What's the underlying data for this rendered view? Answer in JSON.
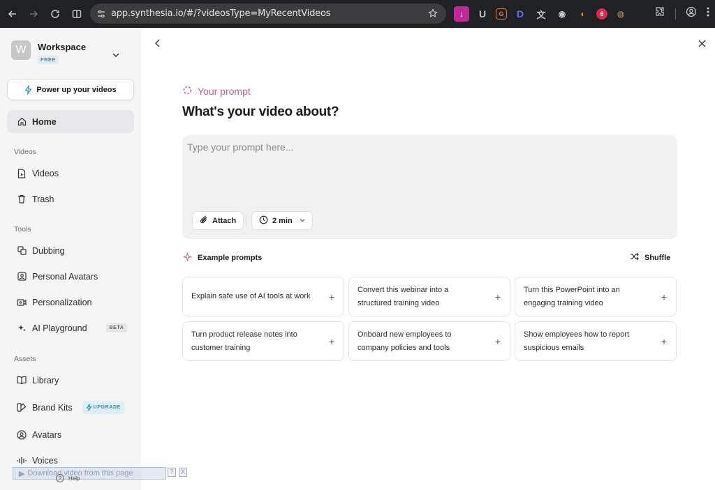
{
  "browser": {
    "url": "app.synthesia.io/#/?videosType=MyRecentVideos",
    "extensions": [
      {
        "name": "downloader-extension",
        "glyph": "↓",
        "bg": "#c0289a"
      },
      {
        "name": "u-extension",
        "glyph": "U",
        "bg": "transparent"
      },
      {
        "name": "grammar-extension",
        "glyph": "G",
        "bg": "transparent"
      },
      {
        "name": "d-extension",
        "glyph": "D",
        "bg": "transparent"
      },
      {
        "name": "translate-extension",
        "glyph": "文",
        "bg": "transparent"
      },
      {
        "name": "camera-extension",
        "glyph": "◉",
        "bg": "transparent"
      },
      {
        "name": "flame-extension",
        "glyph": "◐",
        "bg": "transparent"
      },
      {
        "name": "red-extension",
        "glyph": "6",
        "bg": "transparent"
      },
      {
        "name": "cookie-extension",
        "glyph": "◍",
        "bg": "transparent"
      }
    ]
  },
  "sidebar": {
    "workspace": {
      "initial": "W",
      "name": "Workspace",
      "plan": "FREE"
    },
    "powerup_label": "Power up your videos",
    "home_label": "Home",
    "sections": {
      "videos": "Videos",
      "tools": "Tools",
      "assets": "Assets"
    },
    "items": {
      "videos": "Videos",
      "trash": "Trash",
      "dubbing": "Dubbing",
      "personal_avatars": "Personal Avatars",
      "personalization": "Personalization",
      "ai_playground": "AI Playground",
      "library": "Library",
      "brand_kits": "Brand Kits",
      "avatars": "Avatars",
      "voices": "Voices"
    },
    "beta_badge": "BETA",
    "upgrade_badge": "UPGRADE",
    "help_label": "Help"
  },
  "overlay": {
    "download_label": "Download video from this page",
    "help_glyph": "?",
    "close_glyph": "X"
  },
  "main": {
    "prompt_eyebrow": "Your prompt",
    "title": "What's your video about?",
    "input_placeholder": "Type your prompt here...",
    "input_value": "",
    "attach_label": "Attach",
    "duration_label": "2 min",
    "examples_label": "Example prompts",
    "shuffle_label": "Shuffle",
    "examples": [
      "Explain safe use of AI tools at work",
      "Convert this webinar into a structured training video",
      "Turn this PowerPoint into an engaging training video",
      "Turn product release notes into customer training",
      "Onboard new employees to company policies and tools",
      "Show employees how to report suspicious emails"
    ]
  },
  "colors": {
    "accent_pink": "#c45c9a",
    "accent_teal": "#2e8fae",
    "sidebar_bg": "#f5f5f6",
    "chrome_bg": "#202124"
  }
}
